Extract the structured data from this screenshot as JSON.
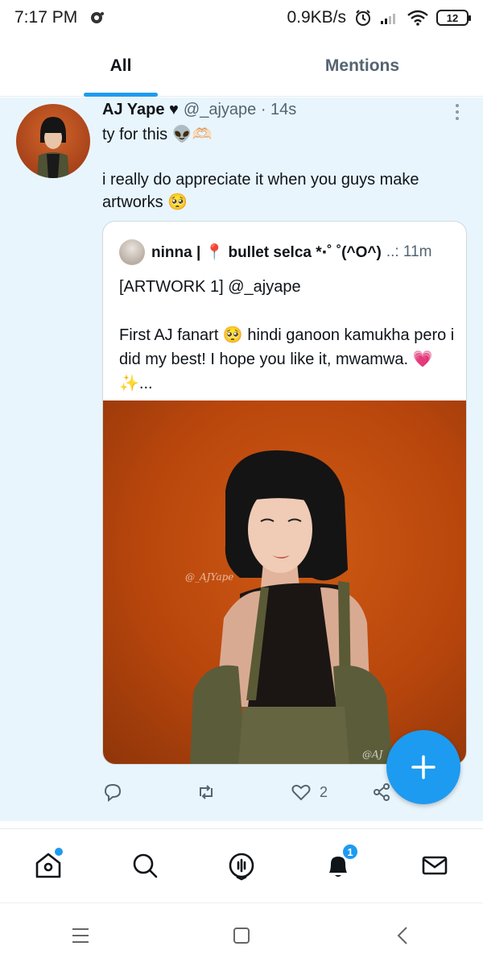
{
  "status_bar": {
    "time": "7:17 PM",
    "network_speed": "0.9KB/s",
    "battery": "12"
  },
  "tabs": [
    {
      "label": "All",
      "active": true
    },
    {
      "label": "Mentions",
      "active": false
    }
  ],
  "tweet": {
    "author_name": "AJ Yape ♥",
    "meta": "@_ajyape · 14s",
    "line1": "ty for this 👽🫶🏻",
    "line2": "i really do appreciate it when you guys make artworks 🥺",
    "quote": {
      "author_name": "ninna | 📍 bullet selca *‧˚ ˚(^O^)",
      "meta": "..: 11m",
      "line1": "[ARTWORK 1] @_ajyape",
      "line2": "First AJ fanart 🥺 hindi ganoon kamukha pero i did my best! I hope you like it, mwamwa. 💗✨..."
    },
    "like_count": "2"
  },
  "colors": {
    "accent": "#1d9bf0",
    "tweet_highlight_bg": "#e8f5fd",
    "secondary_text": "#536471"
  },
  "icons": {
    "home": "home-icon",
    "search": "search-icon",
    "spaces": "spaces-icon",
    "notifications": "bell-icon",
    "messages": "mail-icon"
  },
  "bottom_nav": {
    "notifications_badge": "1"
  }
}
